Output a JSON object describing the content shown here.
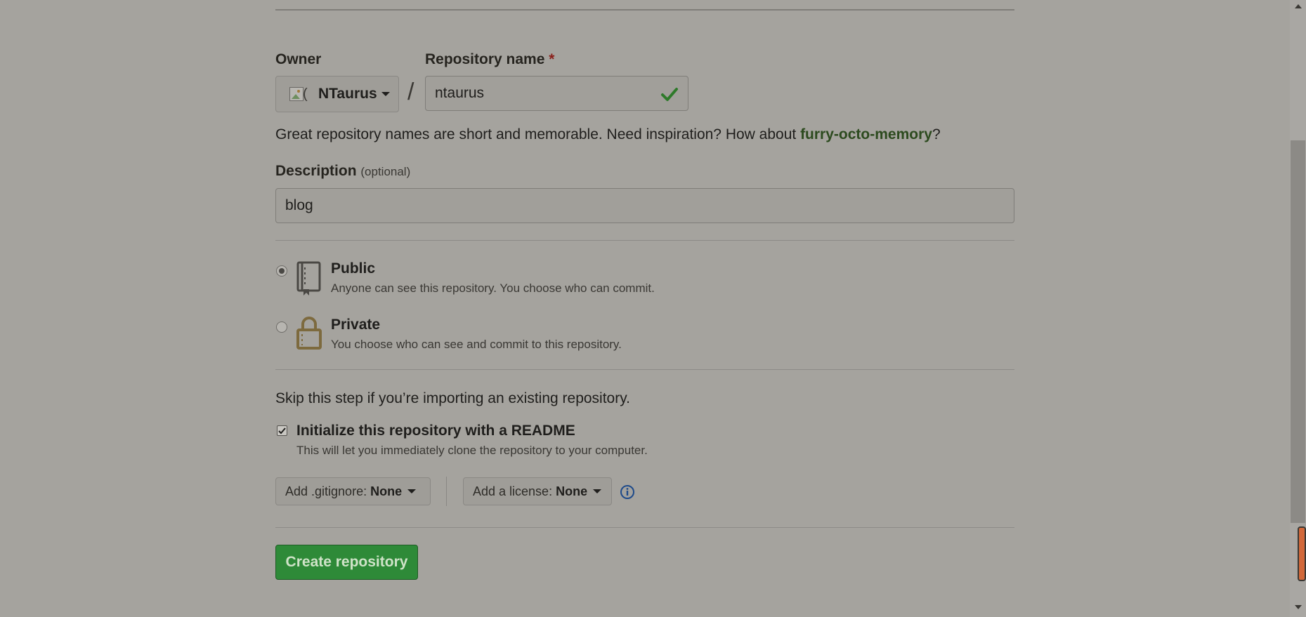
{
  "form": {
    "owner": {
      "label": "Owner",
      "value": "NTaurus",
      "avatar_broken_char": "(",
      "avatar_icon": "broken-image-icon"
    },
    "separator": "/",
    "repo_name": {
      "label": "Repository name",
      "required_mark": "*",
      "value": "ntaurus",
      "valid_icon": "check-icon"
    },
    "name_help": {
      "text": "Great repository names are short and memorable. Need inspiration? How about ",
      "suggestion": "furry-octo-memory",
      "suffix": "?"
    },
    "description": {
      "label": "Description",
      "optional": "(optional)",
      "value": "blog"
    },
    "visibility": {
      "selected": "public",
      "options": [
        {
          "title": "Public",
          "desc": "Anyone can see this repository. You choose who can commit.",
          "icon": "repo-book-icon"
        },
        {
          "title": "Private",
          "desc": "You choose who can see and commit to this repository.",
          "icon": "lock-icon"
        }
      ]
    },
    "skip_text": "Skip this step if you’re importing an existing repository.",
    "init_readme": {
      "checked": true,
      "label": "Initialize this repository with a README",
      "desc": "This will let you immediately clone the repository to your computer."
    },
    "gitignore": {
      "label": "Add .gitignore:",
      "value": "None"
    },
    "license": {
      "label": "Add a license:",
      "value": "None"
    },
    "info_icon": "info-icon",
    "submit_label": "Create repository"
  },
  "colors": {
    "background": "#a5a39e",
    "submit_green": "#2e8a38",
    "suggestion_green": "#2c4a1e",
    "required_red": "#8a1f1a",
    "scroll_indicator": "#d2683a"
  }
}
